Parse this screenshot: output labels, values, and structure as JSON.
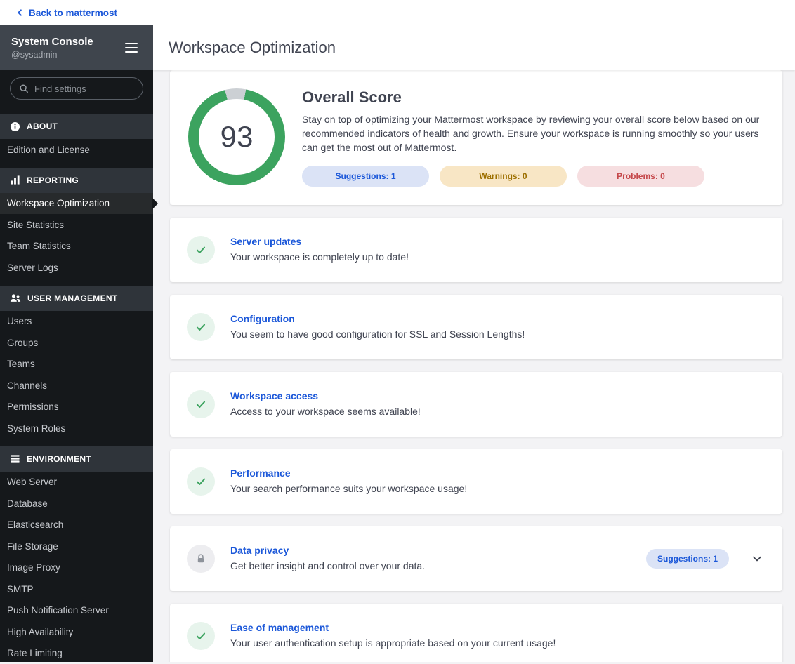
{
  "colors": {
    "accent_blue": "#1c58d9",
    "success_green": "#3ca35f",
    "warning_amber": "#9d6f00",
    "error_red": "#c5484b",
    "sidebar_bg": "#15181b"
  },
  "top_bar": {
    "back_label": "Back to mattermost"
  },
  "sidebar": {
    "title": "System Console",
    "subtitle": "@sysadmin",
    "search_placeholder": "Find settings",
    "active_item": "Workspace Optimization",
    "sections": [
      {
        "label": "ABOUT",
        "items": [
          "Edition and License"
        ]
      },
      {
        "label": "REPORTING",
        "items": [
          "Workspace Optimization",
          "Site Statistics",
          "Team Statistics",
          "Server Logs"
        ]
      },
      {
        "label": "USER MANAGEMENT",
        "items": [
          "Users",
          "Groups",
          "Teams",
          "Channels",
          "Permissions",
          "System Roles"
        ]
      },
      {
        "label": "ENVIRONMENT",
        "items": [
          "Web Server",
          "Database",
          "Elasticsearch",
          "File Storage",
          "Image Proxy",
          "SMTP",
          "Push Notification Server",
          "High Availability",
          "Rate Limiting"
        ]
      }
    ]
  },
  "main": {
    "title": "Workspace Optimization",
    "overall": {
      "score": "93",
      "heading": "Overall Score",
      "description": "Stay on top of optimizing your Mattermost workspace by reviewing your overall score below based on our recommended indicators of health and growth. Ensure your workspace is running smoothly so your users can get the most out of Mattermost.",
      "badges": [
        {
          "label": "Suggestions: 1"
        },
        {
          "label": "Warnings: 0"
        },
        {
          "label": "Problems: 0"
        }
      ]
    },
    "cards": [
      {
        "title": "Server updates",
        "description": "Your workspace is completely up to date!",
        "status": "check"
      },
      {
        "title": "Configuration",
        "description": "You seem to have good configuration for SSL and Session Lengths!",
        "status": "check"
      },
      {
        "title": "Workspace access",
        "description": "Access to your workspace seems available!",
        "status": "check"
      },
      {
        "title": "Performance",
        "description": "Your search performance suits your workspace usage!",
        "status": "check"
      },
      {
        "title": "Data privacy",
        "description": "Get better insight and control over your data.",
        "status": "lock",
        "badge": "Suggestions: 1"
      },
      {
        "title": "Ease of management",
        "description": "Your user authentication setup is appropriate based on your current usage!",
        "status": "check"
      }
    ]
  }
}
